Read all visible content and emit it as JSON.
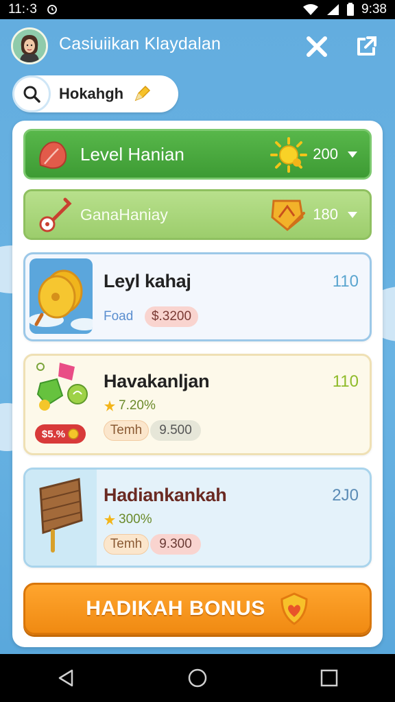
{
  "status_bar": {
    "left_time": "11:·3",
    "right_time": "9:38"
  },
  "header": {
    "title": "Casiuiikan Klaydalan"
  },
  "search": {
    "value": "Hokahgh"
  },
  "bars": [
    {
      "label": "Level Hanian",
      "value": "200"
    },
    {
      "label": "GanaHaniay",
      "value": "180"
    }
  ],
  "cards": [
    {
      "title": "Leyl kahaj",
      "value": "110",
      "caption": "Foad",
      "price": "$.3200"
    },
    {
      "title": "Havakanljan",
      "value": "110",
      "percent": "7.20%",
      "badge": "$5.%",
      "term": "Temh",
      "price": "9.500"
    },
    {
      "title": "Hadiankankah",
      "value": "2J0",
      "percent": "300%",
      "term": "Temh",
      "price": "9.300"
    }
  ],
  "bonus_button": {
    "label": "HADIKAH BONUS"
  },
  "colors": {
    "green_bar": "#45a83b",
    "lightgreen_bar": "#a6d677",
    "orange_button": "#f7951f",
    "sky": "#63addf"
  },
  "icons": {
    "close": "close-icon",
    "share": "share-icon",
    "search": "search-icon",
    "nav_back": "back-icon",
    "nav_home": "home-icon",
    "nav_recents": "recents-icon"
  }
}
